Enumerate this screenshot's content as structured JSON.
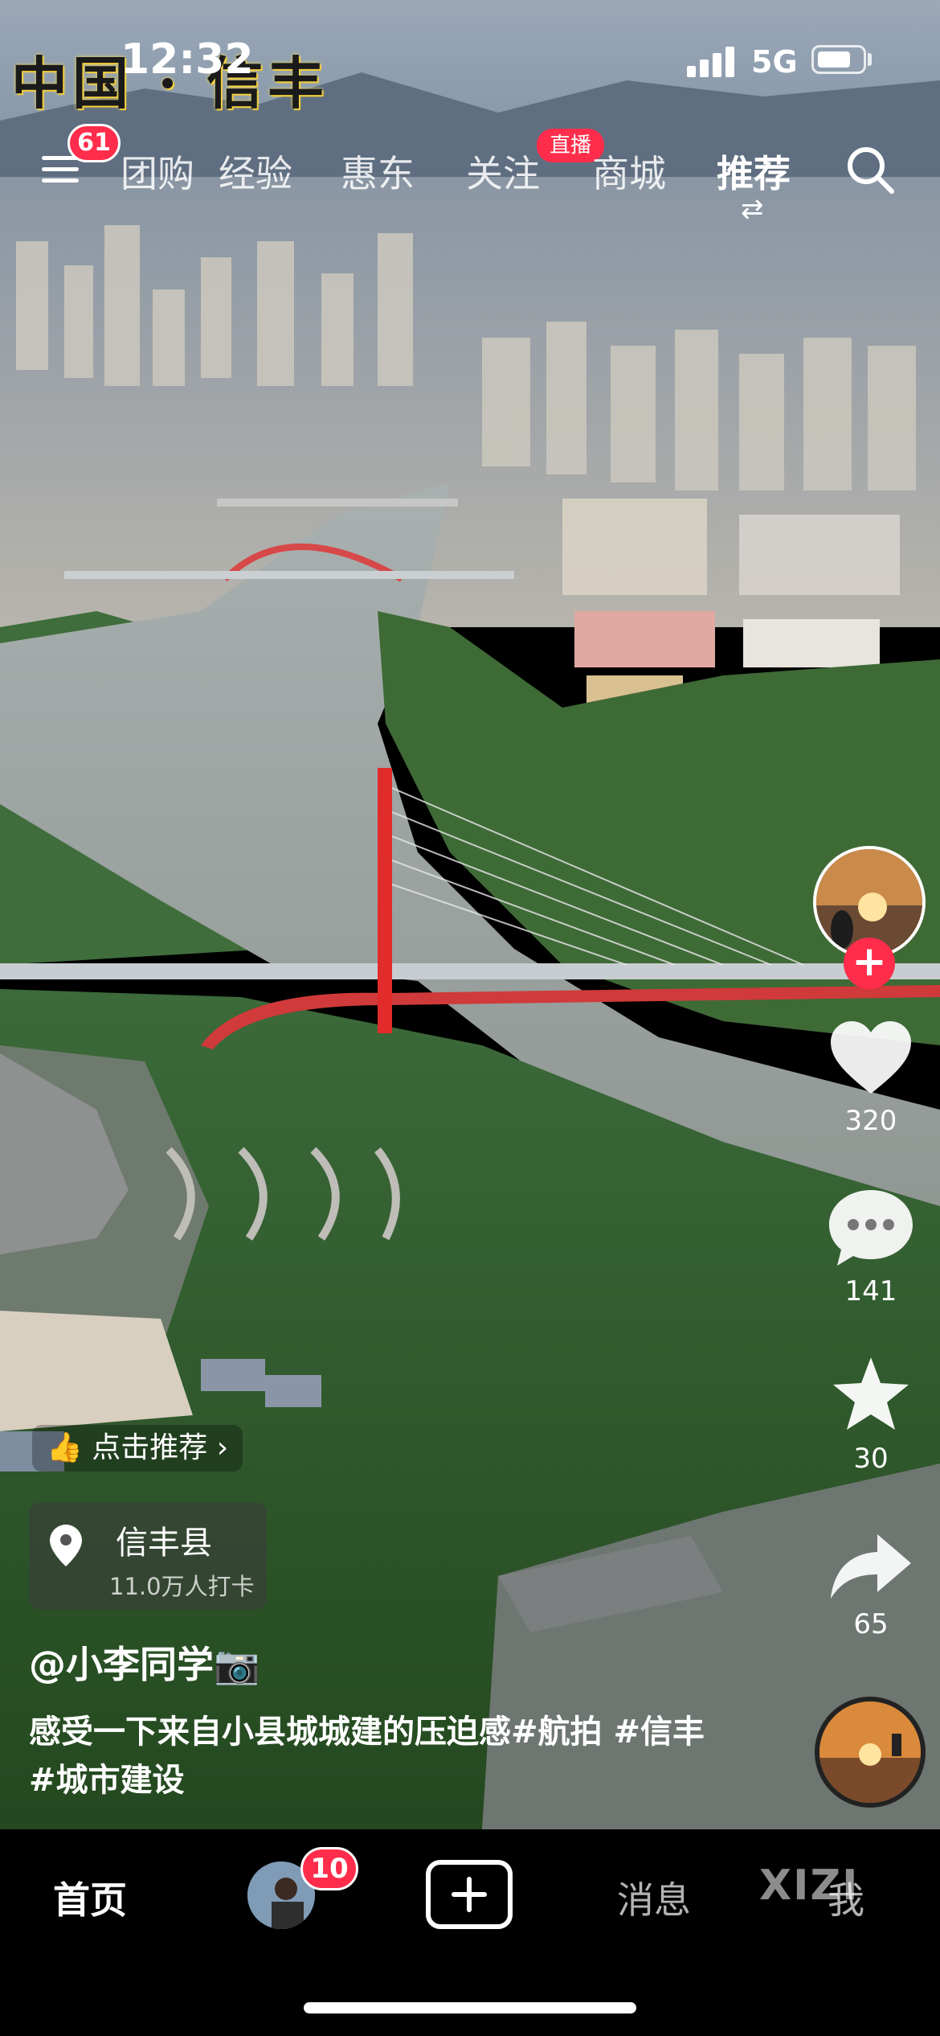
{
  "status_bar": {
    "time": "12:32",
    "network": "5G",
    "watermark_text": "中国 · 信丰"
  },
  "top_nav": {
    "menu_badge": "61",
    "tabs": [
      {
        "label": "团购",
        "active": false
      },
      {
        "label": "经验",
        "active": false
      },
      {
        "label": "惠东",
        "active": false
      },
      {
        "label": "关注",
        "active": false,
        "live_badge": "直播"
      },
      {
        "label": "商城",
        "active": false
      },
      {
        "label": "推荐",
        "active": true
      }
    ]
  },
  "actions": {
    "likes": "320",
    "comments": "141",
    "favorites": "30",
    "shares": "65"
  },
  "video_info": {
    "recommend_label": "点击推荐",
    "location_name": "信丰县",
    "location_checkins": "11.0万人打卡",
    "author": "@小李同学📷",
    "caption": "感受一下来自小县城城建的压迫感#航拍 #信丰 #城市建设"
  },
  "bottom_tabs": {
    "home": "首页",
    "friends_badge": "10",
    "messages": "消息",
    "me": "我",
    "watermark": "XIZI"
  },
  "colors": {
    "accent_red": "#ff2d4b",
    "tab_bar_bg": "#000000"
  },
  "icons": [
    "menu-icon",
    "search-icon",
    "heart-icon",
    "comment-icon",
    "star-icon",
    "share-icon",
    "location-pin-icon",
    "thumbs-up-icon",
    "add-icon"
  ]
}
